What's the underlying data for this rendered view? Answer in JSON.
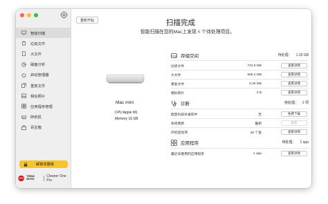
{
  "sidebar": {
    "items": [
      {
        "label": "智能扫描",
        "icon": "monitor-icon",
        "active": true
      },
      {
        "label": "垃圾文件",
        "icon": "trash-icon"
      },
      {
        "label": "大文件",
        "icon": "file-icon"
      },
      {
        "label": "磁盘分析",
        "icon": "pie-chart-icon"
      },
      {
        "label": "启动管理器",
        "icon": "power-icon"
      },
      {
        "label": "重复文件",
        "icon": "copy-icon"
      },
      {
        "label": "相似照片",
        "icon": "photo-icon"
      },
      {
        "label": "应用程序管理",
        "icon": "app-grid-icon"
      },
      {
        "label": "碎纸机",
        "icon": "shredder-icon"
      },
      {
        "label": "百宝箱",
        "icon": "toolbox-icon"
      }
    ],
    "unlock_label": "解锁完整版",
    "brand_trend": "TREND MICRO",
    "brand_name": "Cleaner One Pro"
  },
  "main": {
    "rescan_label": "重新开始",
    "title": "扫描完成",
    "subtitle_prefix": "智能扫描在您的Mac上发现 ",
    "subtitle_count": "6",
    "subtitle_suffix": " 个待处理项目。"
  },
  "device": {
    "name": "Mac mini",
    "cpu": "CPU Apple M1",
    "memory": "Memory 16 GB"
  },
  "storage": {
    "title": "存储空间",
    "pending_label": "待处理：",
    "pending_value": "1.39 GB",
    "rows": [
      {
        "label": "垃圾文件",
        "value": "723.9 MB",
        "button": "查看详情"
      },
      {
        "label": "大文件",
        "value": "656.2 MB",
        "button": "查看详情"
      },
      {
        "label": "重复文件",
        "value": "5.06 MB",
        "button": "查看详情"
      },
      {
        "label": "相似照片",
        "value": "0 B",
        "button": "查看详情"
      }
    ]
  },
  "diagnosis": {
    "title": "诊断",
    "pending_label": "待处理：",
    "pending_value": "2 项",
    "rows": [
      {
        "label": "趋势科技杀毒软件",
        "value": "无",
        "button": "免费下载"
      },
      {
        "label": "系统更新",
        "value": "最新",
        "button": "安装"
      },
      {
        "label": "开机启动项",
        "value": "36 个查",
        "button": "查看详情"
      }
    ]
  },
  "apps": {
    "title": "应用程序",
    "pending_label": "待处理：",
    "pending_value": "1 app",
    "rows": [
      {
        "label": "最近未使用的应用程序",
        "value": "1 app",
        "button": "查看详情"
      }
    ]
  },
  "colors": {
    "accent_yellow": "#f7c42b",
    "count_blue": "#2f8cf0"
  }
}
